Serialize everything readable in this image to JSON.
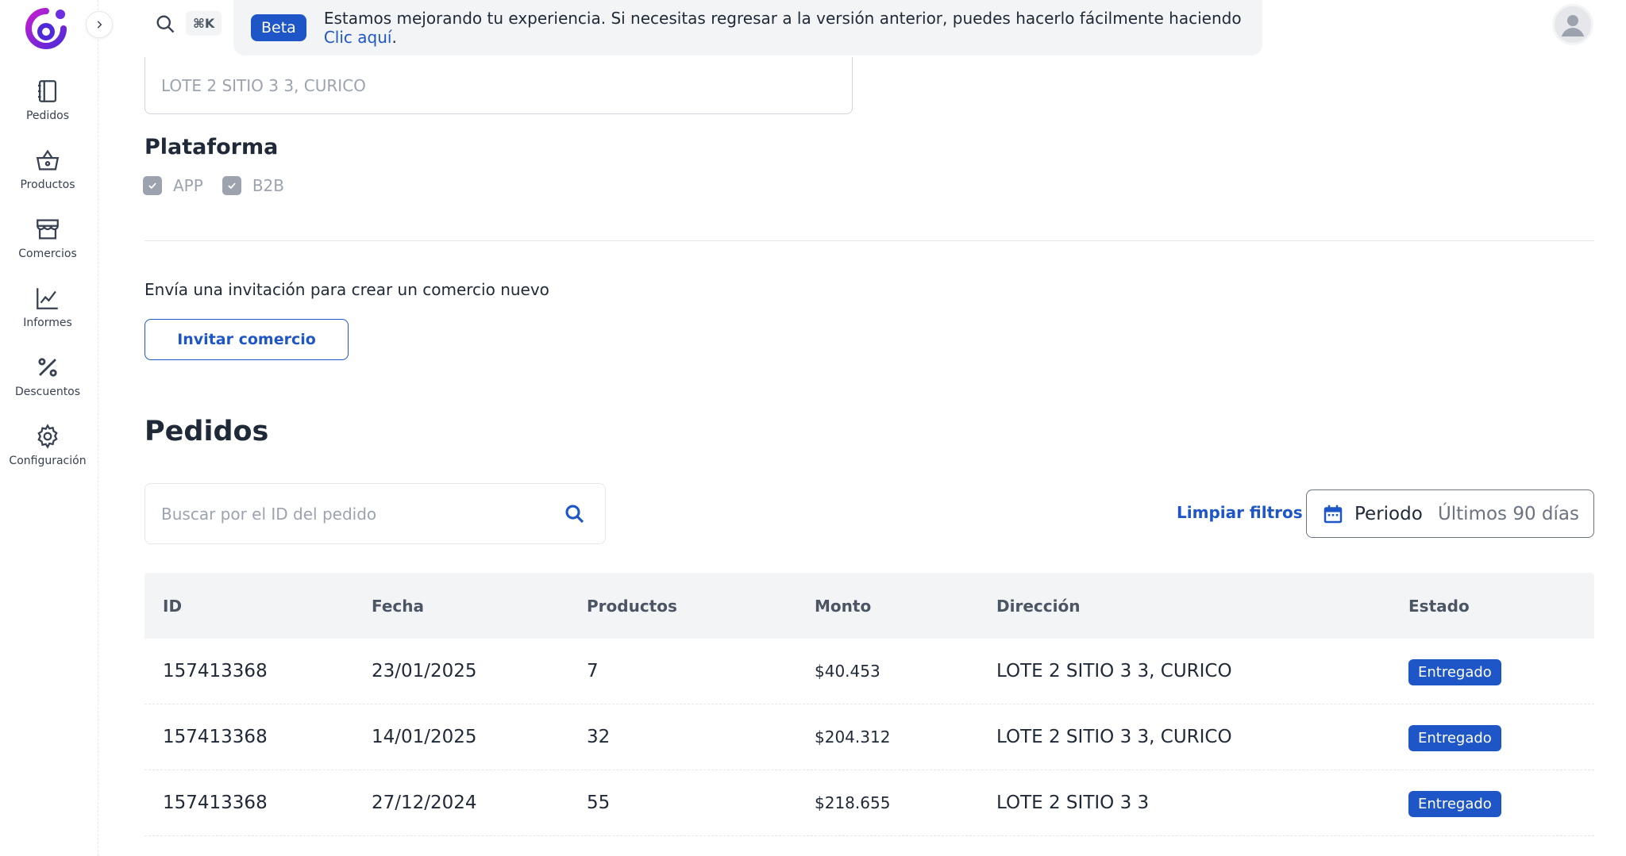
{
  "sidebar": {
    "items": [
      {
        "label": "Pedidos",
        "icon": "notebook-icon"
      },
      {
        "label": "Productos",
        "icon": "basket-icon"
      },
      {
        "label": "Comercios",
        "icon": "store-icon"
      },
      {
        "label": "Informes",
        "icon": "chart-line-icon"
      },
      {
        "label": "Descuentos",
        "icon": "percent-icon"
      },
      {
        "label": "Configuración",
        "icon": "gear-icon"
      }
    ]
  },
  "topbar": {
    "shortcut": "⌘K"
  },
  "banner": {
    "badge": "Beta",
    "text": "Estamos mejorando tu experiencia. Si necesitas regresar a la versión anterior, puedes hacerlo fácilmente haciendo ",
    "link": "Clic aquí",
    "suffix": "."
  },
  "commerce": {
    "address": "LOTE 2 SITIO 3 3, CURICO",
    "platform_title": "Plataforma",
    "platforms": [
      "APP",
      "B2B"
    ],
    "invite_text": "Envía una invitación para crear un comercio nuevo",
    "invite_button": "Invitar comercio"
  },
  "orders": {
    "title": "Pedidos",
    "search_placeholder": "Buscar por el ID del pedido",
    "clear_filters": "Limpiar filtros",
    "period_label": "Periodo",
    "period_value": "Últimos 90 días",
    "columns": [
      "ID",
      "Fecha",
      "Productos",
      "Monto",
      "Dirección",
      "Estado"
    ],
    "rows": [
      {
        "id": "157413368",
        "fecha": "23/01/2025",
        "productos": "7",
        "monto": "$40.453",
        "direccion": "LOTE 2 SITIO 3 3, CURICO",
        "estado": "Entregado"
      },
      {
        "id": "157413368",
        "fecha": "14/01/2025",
        "productos": "32",
        "monto": "$204.312",
        "direccion": "LOTE 2 SITIO 3 3, CURICO",
        "estado": "Entregado"
      },
      {
        "id": "157413368",
        "fecha": "27/12/2024",
        "productos": "55",
        "monto": "$218.655",
        "direccion": "LOTE 2 SITIO 3 3",
        "estado": "Entregado"
      }
    ]
  },
  "colors": {
    "primary": "#1e56c7",
    "logo_gradient_start": "#a01ad6",
    "logo_gradient_end": "#5b2bdb"
  }
}
